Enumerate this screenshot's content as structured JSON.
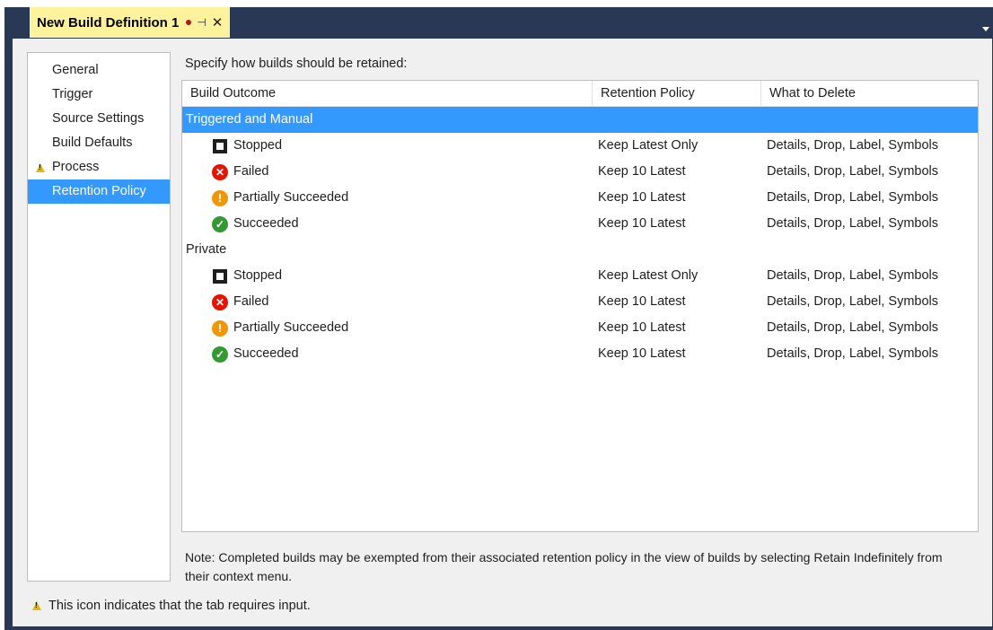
{
  "tab": {
    "title": "New Build Definition 1",
    "pin_glyph": "⊣",
    "close_glyph": "✕"
  },
  "nav": {
    "items": [
      {
        "label": "General",
        "warning": false,
        "selected": false
      },
      {
        "label": "Trigger",
        "warning": false,
        "selected": false
      },
      {
        "label": "Source Settings",
        "warning": false,
        "selected": false
      },
      {
        "label": "Build Defaults",
        "warning": false,
        "selected": false
      },
      {
        "label": "Process",
        "warning": true,
        "selected": false
      },
      {
        "label": "Retention Policy",
        "warning": false,
        "selected": true
      }
    ]
  },
  "main": {
    "instruction": "Specify how builds should be retained:",
    "columns": [
      "Build Outcome",
      "Retention Policy",
      "What to Delete"
    ],
    "groups": [
      {
        "name": "Triggered and Manual",
        "selected": true,
        "rows": [
          {
            "icon": "stopped-icon",
            "outcome": "Stopped",
            "policy": "Keep Latest Only",
            "delete": "Details, Drop, Label, Symbols"
          },
          {
            "icon": "failed-icon",
            "outcome": "Failed",
            "policy": "Keep 10 Latest",
            "delete": "Details, Drop, Label, Symbols"
          },
          {
            "icon": "partially-succeeded-icon",
            "outcome": "Partially Succeeded",
            "policy": "Keep 10 Latest",
            "delete": "Details, Drop, Label, Symbols"
          },
          {
            "icon": "succeeded-icon",
            "outcome": "Succeeded",
            "policy": "Keep 10 Latest",
            "delete": "Details, Drop, Label, Symbols"
          }
        ]
      },
      {
        "name": "Private",
        "selected": false,
        "rows": [
          {
            "icon": "stopped-icon",
            "outcome": "Stopped",
            "policy": "Keep Latest Only",
            "delete": "Details, Drop, Label, Symbols"
          },
          {
            "icon": "failed-icon",
            "outcome": "Failed",
            "policy": "Keep 10 Latest",
            "delete": "Details, Drop, Label, Symbols"
          },
          {
            "icon": "partially-succeeded-icon",
            "outcome": "Partially Succeeded",
            "policy": "Keep 10 Latest",
            "delete": "Details, Drop, Label, Symbols"
          },
          {
            "icon": "succeeded-icon",
            "outcome": "Succeeded",
            "policy": "Keep 10 Latest",
            "delete": "Details, Drop, Label, Symbols"
          }
        ]
      }
    ],
    "note": "Note: Completed builds may be exempted from their associated retention policy in the view of builds by selecting Retain Indefinitely from their context menu."
  },
  "footer": {
    "legend": "This icon indicates that the tab requires input."
  },
  "colors": {
    "accent": "#3399ff",
    "tab_bg": "#fff29d",
    "frame": "#293955",
    "failed": "#e51400",
    "partial": "#f09609",
    "success": "#339933",
    "warning": "#e6b800"
  }
}
